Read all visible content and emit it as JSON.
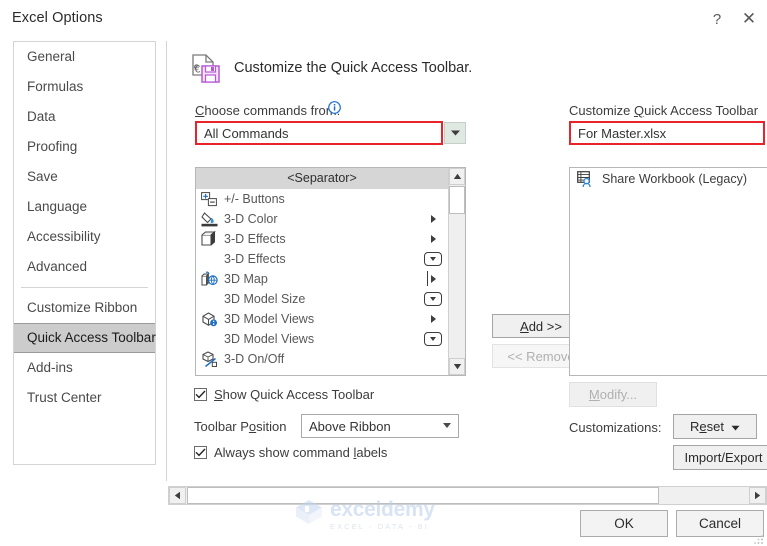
{
  "window": {
    "title": "Excel Options",
    "help_label": "?",
    "close_label": "✕"
  },
  "sidebar": {
    "items": [
      {
        "label": "General",
        "selected": false
      },
      {
        "label": "Formulas",
        "selected": false
      },
      {
        "label": "Data",
        "selected": false
      },
      {
        "label": "Proofing",
        "selected": false
      },
      {
        "label": "Save",
        "selected": false
      },
      {
        "label": "Language",
        "selected": false
      },
      {
        "label": "Accessibility",
        "selected": false
      },
      {
        "label": "Advanced",
        "selected": false
      },
      {
        "label": "Customize Ribbon",
        "selected": false
      },
      {
        "label": "Quick Access Toolbar",
        "selected": true
      },
      {
        "label": "Add-ins",
        "selected": false
      },
      {
        "label": "Trust Center",
        "selected": false
      }
    ],
    "separator_after_index": 7
  },
  "panel": {
    "title": "Customize the Quick Access Toolbar.",
    "icon": "quick-access-toolbar-save-icon",
    "choose_commands_label_pre": "C",
    "choose_commands_label_post": "hoose commands from:",
    "info_icon": "info-icon",
    "customize_label_pre": "Customize ",
    "customize_label_key": "Q",
    "customize_label_post": "uick Access Toolbar"
  },
  "commands_from": {
    "value": "All Commands",
    "arrow_icon": "chevron-down-icon",
    "highlight_color": "#e8242a"
  },
  "qat_target": {
    "value": "For Master.xlsx",
    "highlight_color": "#e8242a"
  },
  "commands_list": {
    "items": [
      {
        "label": "<Separator>",
        "type": "separator",
        "icon": "",
        "tail": ""
      },
      {
        "label": "+/- Buttons",
        "type": "command",
        "icon": "plus-minus-buttons-icon",
        "tail": ""
      },
      {
        "label": "3-D Color",
        "type": "command",
        "icon": "3d-color-icon",
        "tail": "arrow"
      },
      {
        "label": "3-D Effects",
        "type": "command",
        "icon": "3d-effects-icon",
        "tail": "arrow"
      },
      {
        "label": "3-D Effects",
        "type": "command",
        "icon": "",
        "tail": "split"
      },
      {
        "label": "3D Map",
        "type": "command",
        "icon": "3d-map-icon",
        "tail": "arrow-bar"
      },
      {
        "label": "3D Model Size",
        "type": "command",
        "icon": "",
        "tail": "split"
      },
      {
        "label": "3D Model Views",
        "type": "command",
        "icon": "3d-model-views-icon",
        "tail": "arrow"
      },
      {
        "label": "3D Model Views",
        "type": "command",
        "icon": "",
        "tail": "split"
      },
      {
        "label": "3-D On/Off",
        "type": "command",
        "icon": "3d-on-off-icon",
        "tail": ""
      }
    ],
    "scrollbar": {
      "up_icon": "scroll-up-arrow-icon",
      "down_icon": "scroll-down-arrow-icon"
    }
  },
  "qat_list": {
    "items": [
      {
        "label": "Share Workbook (Legacy)",
        "icon": "share-workbook-icon"
      }
    ]
  },
  "transfer_buttons": {
    "add_pre": "A",
    "add_post": "dd >>",
    "add_label": "Add >>",
    "add_enabled": true,
    "remove_pre": "<< R",
    "remove_post": "emove",
    "remove_label": "<< Remove",
    "remove_enabled": false
  },
  "options": {
    "show_qat": {
      "pre": "S",
      "post": "how Quick Access Toolbar",
      "label": "Show Quick Access Toolbar",
      "checked": true
    },
    "toolbar_position": {
      "label_pre": "Toolbar P",
      "label_key": "o",
      "label_post": "sition",
      "label": "Toolbar Position",
      "value": "Above Ribbon",
      "arrow_icon": "chevron-down-icon"
    },
    "always_show_labels": {
      "pre": "Always show command ",
      "key": "l",
      "post": "abels",
      "label": "Always show command labels",
      "checked": true
    }
  },
  "right_controls": {
    "modify_pre": "M",
    "modify_post": "odify...",
    "modify_label": "Modify...",
    "modify_enabled": false,
    "customizations_label": "Customizations:",
    "reset_pre": "R",
    "reset_key": "e",
    "reset_post": "set",
    "reset_label": "Reset",
    "reset_arrow_icon": "chevron-down-icon",
    "import_export_label": "Import/Export"
  },
  "footer": {
    "ok_label": "OK",
    "cancel_label": "Cancel"
  },
  "scrollbar_h": {
    "left_icon": "scroll-left-arrow-icon",
    "right_icon": "scroll-right-arrow-icon"
  },
  "watermark": {
    "name": "exceldemy",
    "tagline": "EXCEL - DATA - BI",
    "logo_icon": "exceldemy-cube-logo-icon"
  }
}
